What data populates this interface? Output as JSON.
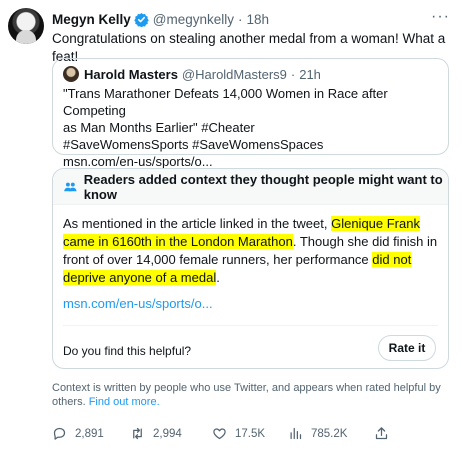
{
  "author": {
    "name": "Megyn Kelly",
    "handle": "@megynkelly",
    "separator": "·",
    "time": "18h",
    "more": "···"
  },
  "tweet_text": "Congratulations on stealing another medal from a woman! What a feat!",
  "quoted": {
    "name": "Harold Masters",
    "handle": "@HaroldMasters9",
    "separator": "·",
    "time": "21h",
    "lines": [
      "\"Trans Marathoner Defeats 14,000 Women in Race after Competing",
      "as Man Months Earlier\" #Cheater",
      "#SaveWomensSports #SaveWomensSpaces",
      "msn.com/en-us/sports/o..."
    ]
  },
  "context": {
    "title": "Readers added context they thought people might want to know",
    "body": {
      "p1": "As mentioned in the article linked in the tweet, ",
      "h1": "Glenique Frank came in 6160th in the London Marathon",
      "p2": ". Though she did finish in front of over 14,000 female runners, her performance ",
      "h2": "did not deprive anyone of a medal",
      "p3": "."
    },
    "link": "msn.com/en-us/sports/o...",
    "question": "Do you find this helpful?",
    "rate_label": "Rate it",
    "highlight_color": "#ffff00"
  },
  "footnote": {
    "text": "Context is written by people who use Twitter, and appears when rated helpful by others.",
    "link": "Find out more."
  },
  "actions": {
    "replies": "2,891",
    "retweets": "2,994",
    "likes": "17.5K",
    "views": "785.2K"
  },
  "colors": {
    "accent": "#1d9bf0",
    "secondary_text": "#536471",
    "border": "#cfd9de"
  }
}
